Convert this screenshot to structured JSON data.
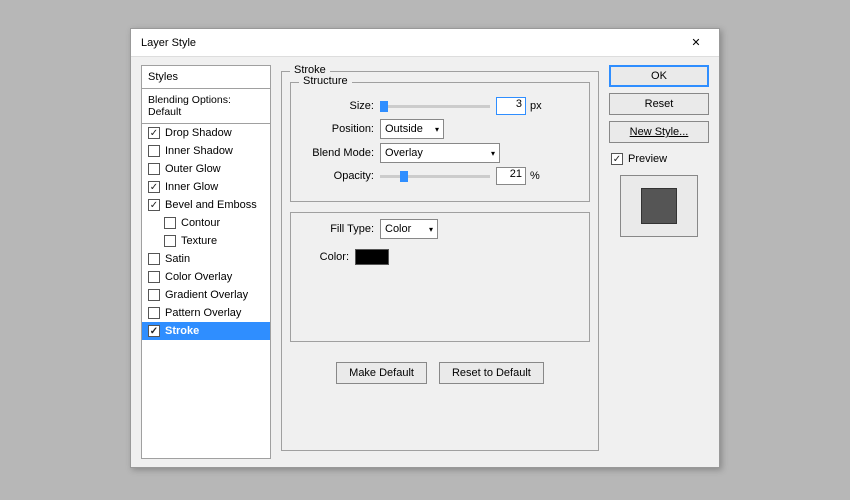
{
  "window": {
    "title": "Layer Style"
  },
  "stylesPanel": {
    "header": "Styles",
    "blending": "Blending Options: Default",
    "items": [
      {
        "label": "Drop Shadow",
        "checked": true
      },
      {
        "label": "Inner Shadow",
        "checked": false
      },
      {
        "label": "Outer Glow",
        "checked": false
      },
      {
        "label": "Inner Glow",
        "checked": true
      },
      {
        "label": "Bevel and Emboss",
        "checked": true
      },
      {
        "label": "Contour",
        "checked": false,
        "indent": true
      },
      {
        "label": "Texture",
        "checked": false,
        "indent": true
      },
      {
        "label": "Satin",
        "checked": false
      },
      {
        "label": "Color Overlay",
        "checked": false
      },
      {
        "label": "Gradient Overlay",
        "checked": false
      },
      {
        "label": "Pattern Overlay",
        "checked": false
      },
      {
        "label": "Stroke",
        "checked": true,
        "selected": true
      }
    ]
  },
  "stroke": {
    "groupTitle": "Stroke",
    "structureTitle": "Structure",
    "sizeLabel": "Size:",
    "sizeValue": "3",
    "sizeUnit": "px",
    "positionLabel": "Position:",
    "positionValue": "Outside",
    "blendLabel": "Blend Mode:",
    "blendValue": "Overlay",
    "opacityLabel": "Opacity:",
    "opacityValue": "21",
    "opacityUnit": "%",
    "fillTypeLabel": "Fill Type:",
    "fillTypeValue": "Color",
    "colorLabel": "Color:",
    "colorValue": "#000000",
    "makeDefault": "Make Default",
    "resetDefault": "Reset to Default"
  },
  "right": {
    "ok": "OK",
    "reset": "Reset",
    "newStyle": "New Style...",
    "previewLabel": "Preview",
    "previewChecked": true
  }
}
